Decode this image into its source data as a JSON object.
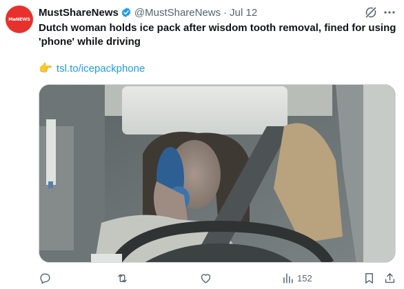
{
  "post": {
    "display_name": "MustShareNews",
    "handle": "@MustShareNews",
    "separator": "·",
    "date": "Jul 12",
    "avatar_text": "M▪NEWS",
    "text": "Dutch woman holds ice pack after wisdom tooth removal, fined for using 'phone' while driving",
    "link_emoji": "👉",
    "link_text": "tsl.to/icepackphone",
    "views": "152"
  },
  "icons": {
    "verified": "verified-badge-icon",
    "grok": "grok-icon",
    "more": "more-icon",
    "reply": "reply-icon",
    "retweet": "retweet-icon",
    "like": "like-icon",
    "views": "views-icon",
    "bookmark": "bookmark-icon",
    "share": "share-icon"
  },
  "colors": {
    "brand_red": "#e8312d",
    "verified_blue": "#1d9bf0",
    "link_blue": "#1d9bf0",
    "muted": "#536471"
  }
}
